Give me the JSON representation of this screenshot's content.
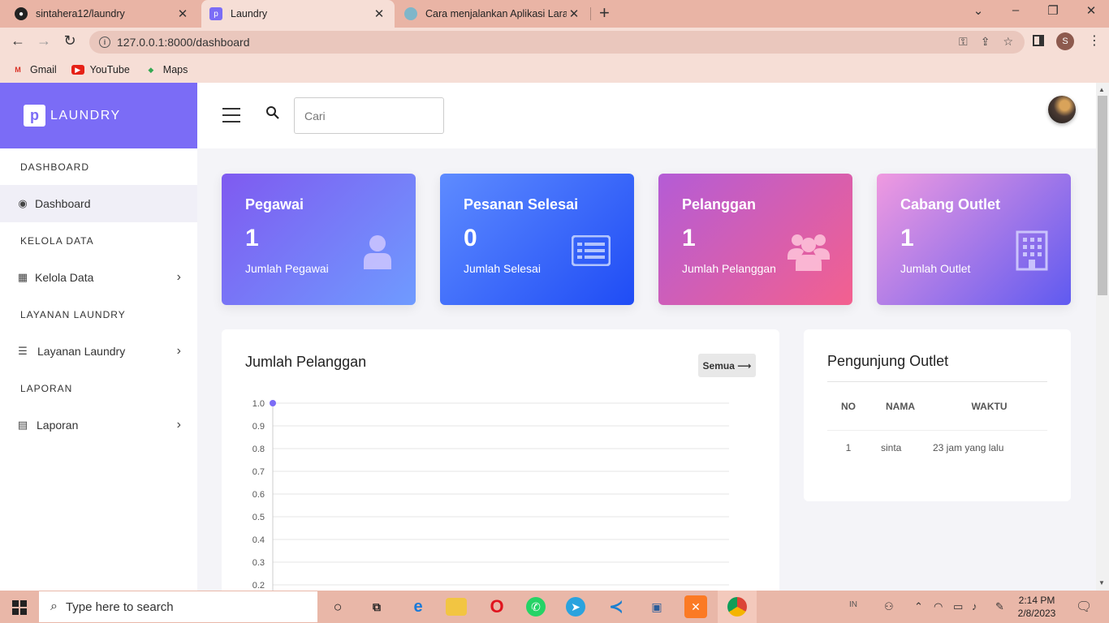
{
  "browser": {
    "tabs": [
      {
        "label": "sintahera12/laundry",
        "icon": "github-icon"
      },
      {
        "label": "Laundry",
        "icon": "laundry-favicon"
      },
      {
        "label": "Cara menjalankan Aplikasi Larave",
        "icon": "globe-icon"
      }
    ],
    "url": "127.0.0.1:8000/dashboard",
    "profile_initial": "S",
    "bookmarks": [
      "Gmail",
      "YouTube",
      "Maps"
    ]
  },
  "sidebar": {
    "brand_logo": "p",
    "brand": "LAUNDRY",
    "sections": [
      {
        "heading": "DASHBOARD",
        "item": "Dashboard",
        "icon": "gauge-icon",
        "has_chevron": false
      },
      {
        "heading": "KELOLA DATA",
        "item": "Kelola Data",
        "icon": "grid-icon",
        "has_chevron": true
      },
      {
        "heading": "LAYANAN LAUNDRY",
        "item": "Layanan Laundry",
        "icon": "server-icon",
        "has_chevron": true
      },
      {
        "heading": "LAPORAN",
        "item": "Laporan",
        "icon": "file-icon",
        "has_chevron": true
      }
    ]
  },
  "topbar": {
    "search_placeholder": "Cari"
  },
  "cards": [
    {
      "title": "Pegawai",
      "value": "1",
      "subtitle": "Jumlah Pegawai",
      "icon": "user-icon"
    },
    {
      "title": "Pesanan Selesai",
      "value": "0",
      "subtitle": "Jumlah Selesai",
      "icon": "list-icon"
    },
    {
      "title": "Pelanggan",
      "value": "1",
      "subtitle": "Jumlah Pelanggan",
      "icon": "users-icon"
    },
    {
      "title": "Cabang Outlet",
      "value": "1",
      "subtitle": "Jumlah Outlet",
      "icon": "building-icon"
    }
  ],
  "chart_panel": {
    "title": "Jumlah Pelanggan",
    "button": "Semua ⟶"
  },
  "chart_data": {
    "type": "line",
    "y_ticks": [
      "1.0",
      "0.9",
      "0.8",
      "0.7",
      "0.6",
      "0.5",
      "0.4",
      "0.3",
      "0.2"
    ],
    "ylim": [
      0,
      1.0
    ],
    "points": [
      {
        "x": 0,
        "y": 1.0
      }
    ],
    "grid": true,
    "color": "#7b6cf6"
  },
  "visitors": {
    "title": "Pengunjung Outlet",
    "columns": [
      "NO",
      "NAMA",
      "WAKTU"
    ],
    "rows": [
      [
        "1",
        "sinta",
        "23 jam yang lalu"
      ]
    ]
  },
  "taskbar": {
    "search_placeholder": "Type here to search",
    "time": "2:14 PM",
    "date": "2/8/2023",
    "lang": "IN"
  },
  "colors": {
    "brand": "#7b6cf6",
    "chrome": "#e9b4a5"
  }
}
